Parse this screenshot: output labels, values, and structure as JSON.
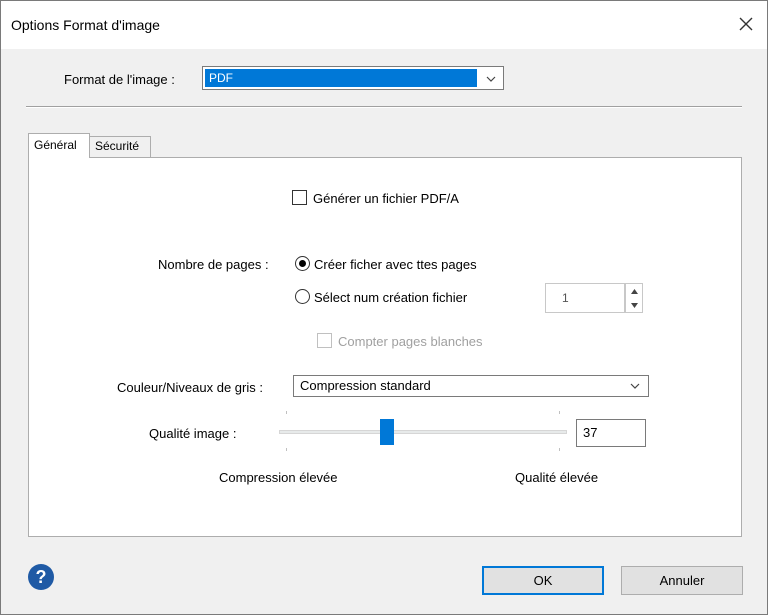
{
  "window": {
    "title": "Options Format d'image"
  },
  "format": {
    "label": "Format de l'image :",
    "selected": "PDF"
  },
  "tabs": [
    {
      "label": "Général"
    },
    {
      "label": "Sécurité"
    }
  ],
  "general": {
    "pdfa_label": "Générer un fichier PDF/A",
    "pdfa_checked": false,
    "pages_label": "Nombre de pages :",
    "radio_all_label": "Créer ficher avec ttes pages",
    "radio_select_label": "Sélect num création fichier",
    "selected_radio": "all",
    "page_count": "1",
    "count_blank_label": "Compter pages blanches",
    "color_label": "Couleur/Niveaux de gris :",
    "color_selected": "Compression standard",
    "quality_label": "Qualité image :",
    "quality_value": "37",
    "quality_fraction": 0.37,
    "low_label": "Compression élevée",
    "high_label": "Qualité élevée"
  },
  "buttons": {
    "ok": "OK",
    "cancel": "Annuler"
  },
  "colors": {
    "accent": "#0078d7",
    "help": "#1f5aa5"
  },
  "icons": [
    "close-icon",
    "chevron-down-icon",
    "spin-up-icon",
    "spin-down-icon",
    "help-icon"
  ]
}
